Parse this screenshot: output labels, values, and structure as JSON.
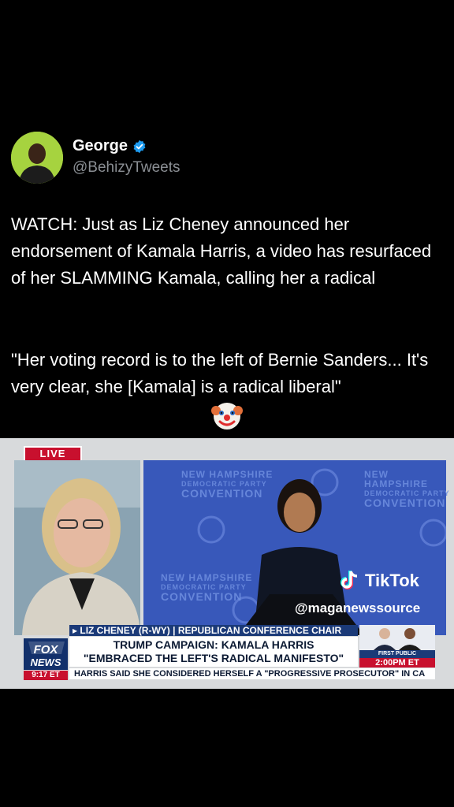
{
  "tweet": {
    "author_name": "George",
    "author_handle": "@BehizyTweets",
    "paragraph_1": "WATCH: Just as Liz Cheney announced her endorsement of Kamala Harris, a video has resurfaced of her SLAMMING Kamala, calling her a radical",
    "paragraph_2": "\"Her voting record is to the left of Bernie Sanders... It's very clear, she [Kamala] is a radical liberal\"",
    "emoji_icon": "clown-face-icon",
    "verified_color": "#1d9bf0"
  },
  "video": {
    "live_badge": "LIVE",
    "backdrop_text": [
      "NEW HAMPSHIRE",
      "DEMOCRATIC PARTY",
      "CONVENTION"
    ],
    "chyron_top": "▸ LIZ CHENEY (R-WY) | REPUBLICAN CONFERENCE CHAIR",
    "chyron_main_line1": "TRUMP CAMPAIGN: KAMALA HARRIS",
    "chyron_main_line2": "\"EMBRACED THE LEFT'S RADICAL MANIFESTO\"",
    "chyron_bottom": "HARRIS SAID SHE CONSIDERED HERSELF A \"PROGRESSIVE PROSECUTOR\" IN CA",
    "network_logo": "FOX NEWS",
    "clock": "9:17 ET",
    "first_appearance_label": "FIRST PUBLIC APPEARANCE",
    "first_appearance_time": "2:00PM ET",
    "tiktok_logo": "TikTok",
    "tiktok_handle": "@maganewssource"
  }
}
